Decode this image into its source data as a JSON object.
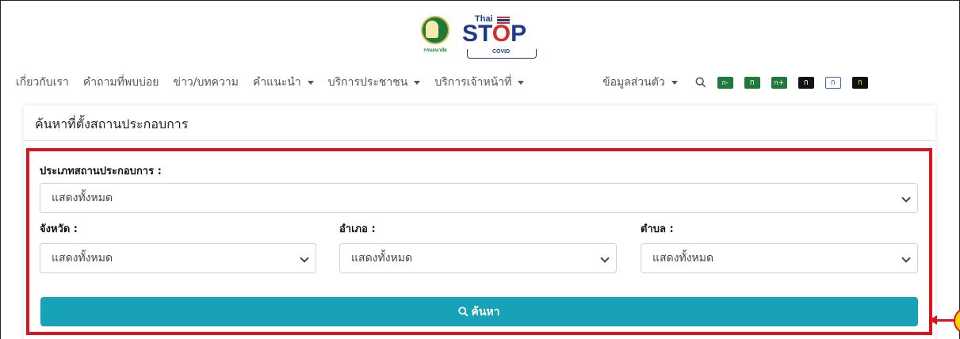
{
  "header": {
    "logo": {
      "seal_text": "กรมอนามัย",
      "brand_top": "Thai",
      "brand_main_left": "ST",
      "brand_main_o": "O",
      "brand_main_right": "P",
      "brand_sub": "COVID"
    },
    "nav": {
      "items": [
        {
          "label": "เกี่ยวกับเรา",
          "dropdown": false
        },
        {
          "label": "คำถามที่พบบ่อย",
          "dropdown": false
        },
        {
          "label": "ข่าว/บทความ",
          "dropdown": false
        },
        {
          "label": "คำแนะนำ",
          "dropdown": true
        },
        {
          "label": "บริการประชาชน",
          "dropdown": true
        },
        {
          "label": "บริการเจ้าหน้าที่",
          "dropdown": true
        }
      ],
      "profile_label": "ข้อมูลส่วนตัว",
      "accessibility": [
        {
          "label": "ก-",
          "style": "green",
          "icon": "font-decrease-icon"
        },
        {
          "label": "ก",
          "style": "green",
          "icon": "font-normal-icon"
        },
        {
          "label": "ก+",
          "style": "green",
          "icon": "font-increase-icon"
        },
        {
          "label": "ก",
          "style": "black",
          "icon": "contrast-black-icon"
        },
        {
          "label": "ก",
          "style": "white",
          "icon": "contrast-white-icon"
        },
        {
          "label": "ก",
          "style": "yellow",
          "icon": "contrast-yellow-icon"
        }
      ]
    }
  },
  "form": {
    "title": "ค้นหาที่ตั้งสถานประกอบการ",
    "business_type_label": "ประเภทสถานประกอบการ :",
    "business_type_value": "แสดงทั้งหมด",
    "province_label": "จังหวัด :",
    "province_value": "แสดงทั้งหมด",
    "district_label": "อำเภอ :",
    "district_value": "แสดงทั้งหมด",
    "subdistrict_label": "ตำบล :",
    "subdistrict_value": "แสดงทั้งหมด",
    "search_label": "ค้นหา"
  },
  "colors": {
    "accent": "#17a2b8",
    "highlight": "#e0121b",
    "callout": "#f6d400",
    "brand_green": "#1d7a3a",
    "brand_blue": "#1b3c8c"
  }
}
